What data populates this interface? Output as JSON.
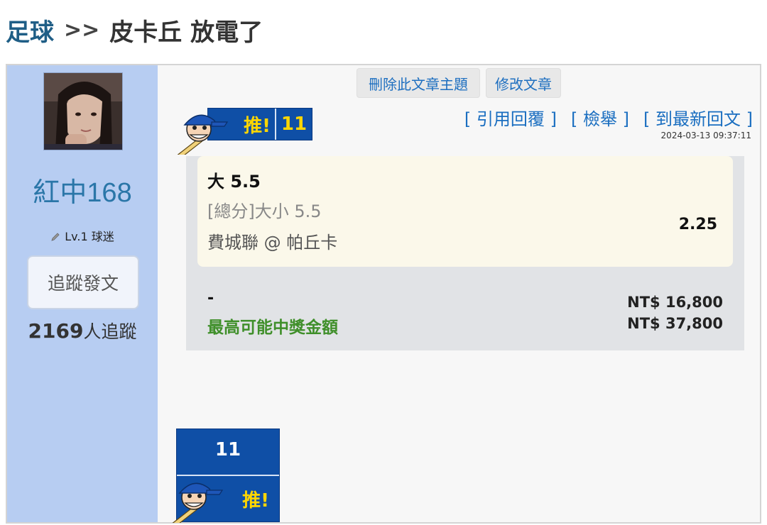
{
  "breadcrumb": {
    "category": "足球",
    "separator": ">>",
    "title": "皮卡丘 放電了"
  },
  "sidebar": {
    "user_name": "紅中168",
    "level": "Lv.1 球迷",
    "follow_button": "追蹤發文",
    "follower_count": "2169",
    "follower_suffix": "人追蹤"
  },
  "actions": {
    "delete_topic": "刪除此文章主題",
    "edit_post": "修改文章"
  },
  "push": {
    "label": "推!",
    "count": "11"
  },
  "post_links": {
    "quote_reply": "引用回覆",
    "report": "檢舉",
    "latest_reply": "到最新回文",
    "open_bracket": "[",
    "close_bracket": "]"
  },
  "timestamp": "2024-03-13 09:37:11",
  "bet": {
    "pick": "大 5.5",
    "market": "[總分]大小 5.5",
    "match": "費城聯 @ 帕丘卡",
    "odds": "2.25",
    "stake_label": "-",
    "stake_amount": "NT$ 16,800",
    "max_payout_label": "最高可能中獎金額",
    "max_payout_amount": "NT$ 37,800"
  },
  "colors": {
    "sidebar_bg": "#b7cdf2",
    "push_blue": "#0f4fa6",
    "push_yellow": "#ffd600",
    "link_blue": "#1a6ec0",
    "payout_green": "#3f8f2a"
  },
  "icons": {
    "level_icon": "pencil-icon",
    "push_mascot": "baseball-mascot-icon"
  }
}
